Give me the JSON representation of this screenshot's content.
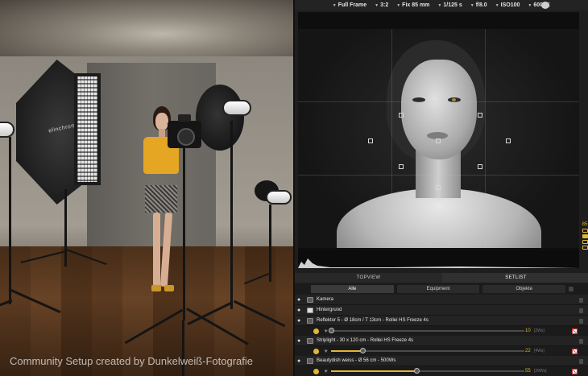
{
  "toolbar": {
    "items": [
      {
        "label": "Full Frame"
      },
      {
        "label": "3:2"
      },
      {
        "label": "Fix 85 mm"
      },
      {
        "label": "1/125 s"
      },
      {
        "label": "f/8.0"
      },
      {
        "label": "ISO100"
      },
      {
        "label": "6000K"
      }
    ]
  },
  "viewport": {
    "credit": "Community Setup created by Dunkelweiß-Fotografie",
    "softbox_brand": "elinchrom"
  },
  "preview_side": {
    "focal_number": "85"
  },
  "tabs": {
    "topview": "TOPVIEW",
    "setlist": "SETLIST"
  },
  "filters": {
    "all": "Alle",
    "equipment": "Equipment",
    "objects": "Objekte"
  },
  "setlist": {
    "items": [
      {
        "label": "Kamera"
      },
      {
        "label": "Hintergrund"
      },
      {
        "label": "Reflektor 5 - Ø 18cm / T 13cm - Rollei HS Freeze 4s",
        "power": 10,
        "power_label": "10",
        "ws": "[2Ws]",
        "fraction": 0.0
      },
      {
        "label": "Striplight - 30 x 120 cm - Rollei HS Freeze 4s",
        "power": 22,
        "power_label": "22",
        "ws": "[4Ws]",
        "fraction": 0.16
      },
      {
        "label": "Beautydish weiss - Ø 56 cm - 500Ws",
        "power": 55,
        "power_label": "55",
        "ws": "[29Ws]",
        "fraction": 0.44
      }
    ]
  },
  "colors": {
    "accent": "#e2b634",
    "panel_bg": "#1e1e1e",
    "row_bg": "#232323"
  }
}
